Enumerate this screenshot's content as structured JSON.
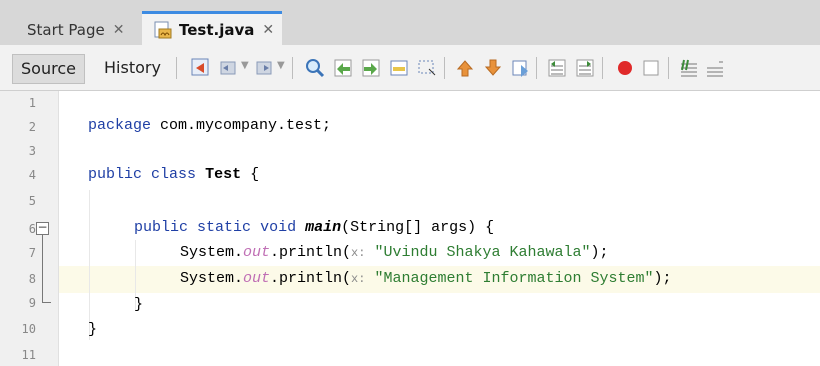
{
  "tabs": [
    {
      "label": "Start Page",
      "close": "✕",
      "active": false
    },
    {
      "label": "Test.java",
      "close": "✕",
      "active": true
    }
  ],
  "toolbar": {
    "source_label": "Source",
    "history_label": "History"
  },
  "editor": {
    "line_numbers": [
      "1",
      "2",
      "3",
      "4",
      "5",
      "6",
      "7",
      "8",
      "9",
      "10",
      "11"
    ],
    "fold_toggle": "−",
    "package_kw": "package",
    "package_name": "com.mycompany.test;",
    "class_public": "public",
    "class_kw": "class",
    "class_name": "Test",
    "brace_open": "{",
    "method_public": "public",
    "method_static": "static",
    "method_void": "void",
    "method_name": "main",
    "method_params": "(String[] args) {",
    "stmt1_prefix": "System.",
    "stmt1_field": "out",
    "stmt1_call": ".println(",
    "stmt1_hint": "x:",
    "stmt1_arg": "\"Uvindu Shakya Kahawala\"",
    "stmt1_end": ");",
    "stmt2_prefix": "System.",
    "stmt2_field": "out",
    "stmt2_call": ".println(",
    "stmt2_hint": "x:",
    "stmt2_arg": "\"Management Information System\"",
    "stmt2_end": ");",
    "brace_close_method": "}",
    "brace_close_class": "}"
  },
  "colors": {
    "keyword": "#1f3fa5",
    "string": "#2e7d32",
    "field": "#c06fb5",
    "highlight": "#fcfae8",
    "active_tab_accent": "#3d8be2"
  }
}
